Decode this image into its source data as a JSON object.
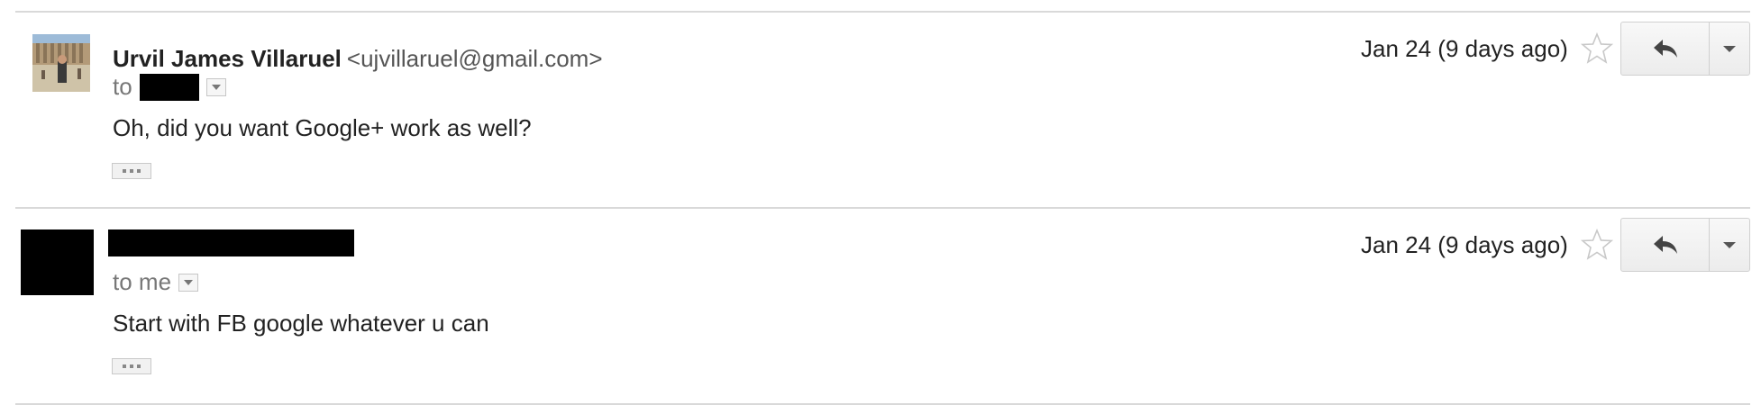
{
  "messages": [
    {
      "sender_name": "Urvil James Villaruel",
      "sender_email": "<ujvillaruel@gmail.com>",
      "to_prefix": "to",
      "to_recipient_redacted": true,
      "body": "Oh, did you want Google+ work as well?",
      "date": "Jan 24 (9 days ago)",
      "avatar": "photo",
      "starred": false
    },
    {
      "sender_name_redacted": true,
      "to_prefix": "to me",
      "body": "Start with FB google whatever u can",
      "date": "Jan 24 (9 days ago)",
      "avatar": "redacted",
      "starred": false
    }
  ],
  "icons": {
    "star": "star-outline-icon",
    "reply": "reply-arrow-icon",
    "more": "chevron-down-icon",
    "details": "details-dropdown-icon",
    "trimmed": "ellipsis-icon"
  },
  "colors": {
    "divider": "#d9d9d9",
    "text": "#222222",
    "muted": "#777777"
  }
}
